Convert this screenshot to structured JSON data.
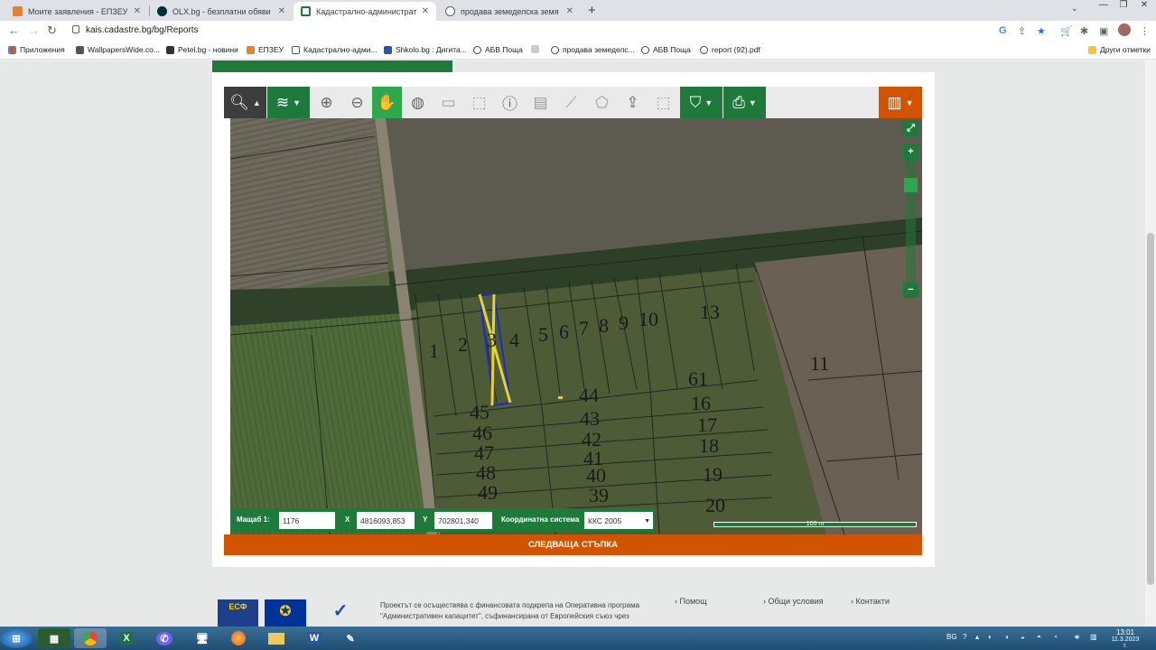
{
  "browser": {
    "tabs": [
      {
        "title": "Моите заявления - ЕПЗЕУ",
        "icon": "epzeu-favicon",
        "active": false
      },
      {
        "title": "OLX.bg - безплатни обяви",
        "icon": "olx-favicon",
        "active": false
      },
      {
        "title": "Кадастрално-административна",
        "icon": "cadastre-favicon",
        "active": true
      },
      {
        "title": "продава земеделска земя",
        "icon": "globe-favicon",
        "active": false
      }
    ],
    "url": "kais.cadastre.bg/bg/Reports",
    "bookmarks": [
      "Приложения",
      "WallpapersWide.co...",
      "Petel.bg - новини",
      "ЕПЗЕУ",
      "Кадастрално-адми...",
      "Shkolo.bg : Дигита...",
      "АБВ Поща",
      "продава земеделс...",
      "АБВ Поща",
      "report (92).pdf"
    ],
    "other_bookmarks": "Други отметки"
  },
  "map": {
    "parcel_labels": [
      "1",
      "2",
      "3",
      "4",
      "5",
      "6",
      "7",
      "8",
      "9",
      "10",
      "13",
      "11",
      "61",
      "16",
      "17",
      "18",
      "19",
      "20",
      "44",
      "43",
      "42",
      "41",
      "40",
      "39",
      "45",
      "46",
      "47",
      "48",
      "49"
    ],
    "zoom_in": "+",
    "zoom_out": "−",
    "fullscreen": "⤢"
  },
  "coords": {
    "scale_label": "Мащаб  1:",
    "scale_value": "1176",
    "x_label": "X",
    "x_value": "4816093,853",
    "y_label": "Y",
    "y_value": "702801,340",
    "system_label": "Координатна система",
    "system_value": "ККС 2005"
  },
  "scale_bar": "100 m",
  "next_step": "СЛЕДВАЩА СТЪПКА",
  "footer": {
    "text_line1": "Проектът се осъществява с финансовата подкрепа на Оперативна програма",
    "text_line2": "\"Административен капацитет\", съфинансирана от Европейския съюз чрез",
    "links": [
      "Помощ",
      "Общи условия",
      "Контакти"
    ]
  },
  "taskbar": {
    "lang": "BG",
    "time": "13:01",
    "date": "11.3.2023 г."
  },
  "colors": {
    "accent_green": "#1d7a3a",
    "accent_orange": "#d35400",
    "selection_yellow": "#e8d233",
    "selection_blue": "#1a2ccc"
  }
}
